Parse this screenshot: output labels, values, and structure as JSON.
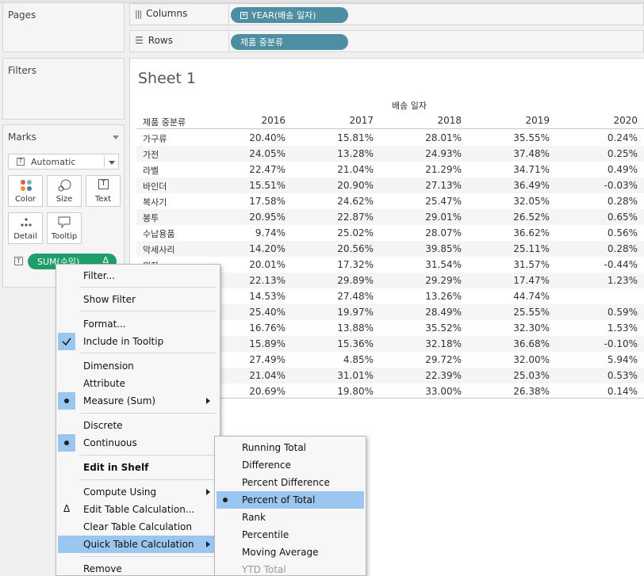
{
  "panels": {
    "pages": "Pages",
    "filters": "Filters",
    "marks": "Marks"
  },
  "shelves": {
    "columns": {
      "label": "Columns",
      "pill": "YEAR(배송 일자)"
    },
    "rows": {
      "label": "Rows",
      "pill": "제품 중분류"
    }
  },
  "marks": {
    "type": "Automatic",
    "buttons": [
      "Color",
      "Size",
      "Text",
      "Detail",
      "Tooltip"
    ],
    "pill": "SUM(수익)",
    "pill_delta": "Δ"
  },
  "sheet": {
    "title": "Sheet 1",
    "col_field": "배송 일자",
    "row_field": "제품 중분류",
    "years": [
      "2016",
      "2017",
      "2018",
      "2019",
      "2020"
    ],
    "rows": [
      {
        "cat": "가구류",
        "v": [
          "20.40%",
          "15.81%",
          "28.01%",
          "35.55%",
          "0.24%"
        ]
      },
      {
        "cat": "가전",
        "v": [
          "24.05%",
          "13.28%",
          "24.93%",
          "37.48%",
          "0.25%"
        ]
      },
      {
        "cat": "라벨",
        "v": [
          "22.47%",
          "21.04%",
          "21.29%",
          "34.71%",
          "0.49%"
        ]
      },
      {
        "cat": "바인더",
        "v": [
          "15.51%",
          "20.90%",
          "27.13%",
          "36.49%",
          "-0.03%"
        ]
      },
      {
        "cat": "복사기",
        "v": [
          "17.58%",
          "24.62%",
          "25.47%",
          "32.05%",
          "0.28%"
        ]
      },
      {
        "cat": "봉투",
        "v": [
          "20.95%",
          "22.87%",
          "29.01%",
          "26.52%",
          "0.65%"
        ]
      },
      {
        "cat": "수납용품",
        "v": [
          "9.74%",
          "25.02%",
          "28.07%",
          "36.62%",
          "0.56%"
        ]
      },
      {
        "cat": "악세사리",
        "v": [
          "14.20%",
          "20.56%",
          "39.85%",
          "25.11%",
          "0.28%"
        ]
      },
      {
        "cat": "의자",
        "v": [
          "20.01%",
          "17.32%",
          "31.54%",
          "31.57%",
          "-0.44%"
        ]
      },
      {
        "cat": "",
        "v": [
          "22.13%",
          "29.89%",
          "29.29%",
          "17.47%",
          "1.23%"
        ]
      },
      {
        "cat": "",
        "v": [
          "14.53%",
          "27.48%",
          "13.26%",
          "44.74%",
          ""
        ]
      },
      {
        "cat": "",
        "v": [
          "25.40%",
          "19.97%",
          "28.49%",
          "25.55%",
          "0.59%"
        ]
      },
      {
        "cat": "",
        "v": [
          "16.76%",
          "13.88%",
          "35.52%",
          "32.30%",
          "1.53%"
        ]
      },
      {
        "cat": "",
        "v": [
          "15.89%",
          "15.36%",
          "32.18%",
          "36.68%",
          "-0.10%"
        ]
      },
      {
        "cat": "",
        "v": [
          "27.49%",
          "4.85%",
          "29.72%",
          "32.00%",
          "5.94%"
        ]
      },
      {
        "cat": "",
        "v": [
          "21.04%",
          "31.01%",
          "22.39%",
          "25.03%",
          "0.53%"
        ]
      },
      {
        "cat": "",
        "v": [
          "20.69%",
          "19.80%",
          "33.00%",
          "26.38%",
          "0.14%"
        ]
      }
    ]
  },
  "context_menu": {
    "filter": "Filter...",
    "show_filter": "Show Filter",
    "format": "Format...",
    "include_tooltip": "Include in Tooltip",
    "dimension": "Dimension",
    "attribute": "Attribute",
    "measure": "Measure (Sum)",
    "discrete": "Discrete",
    "continuous": "Continuous",
    "edit_shelf": "Edit in Shelf",
    "compute_using": "Compute Using",
    "edit_table_calc": "Edit Table Calculation...",
    "clear_table_calc": "Clear Table Calculation",
    "quick_table_calc": "Quick Table Calculation",
    "remove": "Remove"
  },
  "submenu": {
    "running_total": "Running Total",
    "difference": "Difference",
    "percent_difference": "Percent Difference",
    "percent_of_total": "Percent of Total",
    "rank": "Rank",
    "percentile": "Percentile",
    "moving_average": "Moving Average",
    "ytd_total": "YTD Total"
  }
}
